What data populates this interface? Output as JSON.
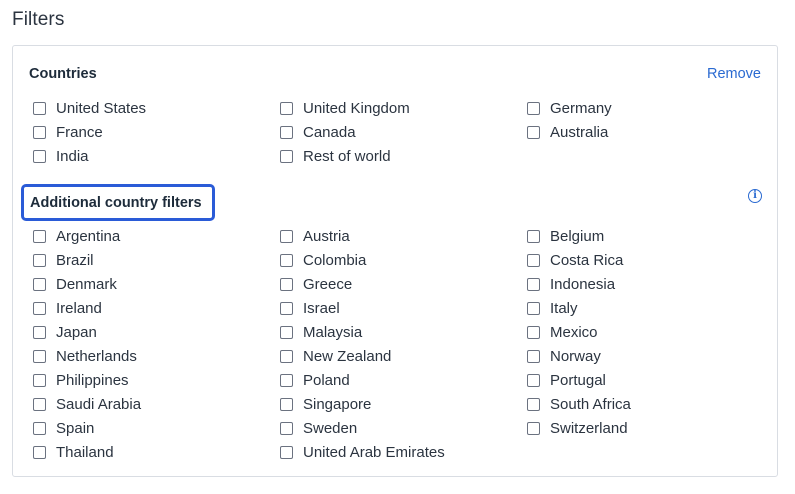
{
  "page": {
    "title": "Filters"
  },
  "countries": {
    "heading": "Countries",
    "remove_label": "Remove",
    "items": [
      "United States",
      "United Kingdom",
      "Germany",
      "France",
      "Canada",
      "Australia",
      "India",
      "Rest of world"
    ]
  },
  "additional": {
    "heading": "Additional country filters",
    "info_icon": "info-icon",
    "items": [
      "Argentina",
      "Austria",
      "Belgium",
      "Brazil",
      "Colombia",
      "Costa Rica",
      "Denmark",
      "Greece",
      "Indonesia",
      "Ireland",
      "Israel",
      "Italy",
      "Japan",
      "Malaysia",
      "Mexico",
      "Netherlands",
      "New Zealand",
      "Norway",
      "Philippines",
      "Poland",
      "Portugal",
      "Saudi Arabia",
      "Singapore",
      "South Africa",
      "Spain",
      "Sweden",
      "Switzerland",
      "Thailand",
      "United Arab Emirates"
    ]
  },
  "colors": {
    "accent": "#2a6ad1",
    "focus": "#2a5bd7",
    "border": "#d9dde3"
  }
}
